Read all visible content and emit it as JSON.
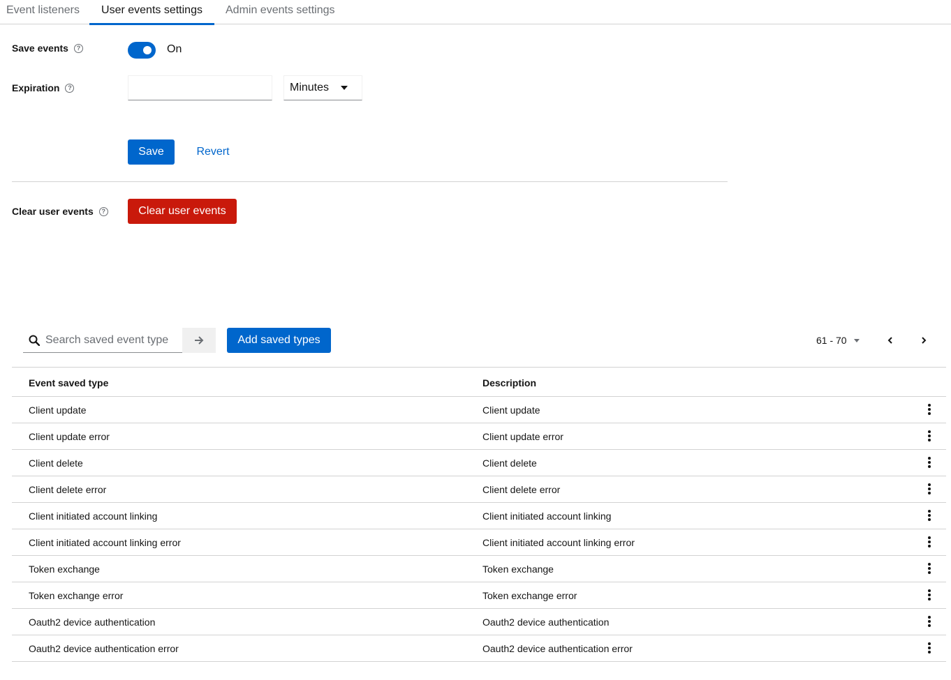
{
  "tabs": [
    {
      "label": "Event listeners"
    },
    {
      "label": "User events settings"
    },
    {
      "label": "Admin events settings"
    }
  ],
  "save_events": {
    "label": "Save events",
    "state_label": "On"
  },
  "expiration": {
    "label": "Expiration",
    "value": "",
    "unit": "Minutes"
  },
  "actions": {
    "save": "Save",
    "revert": "Revert"
  },
  "clear": {
    "label": "Clear user events",
    "button": "Clear user events"
  },
  "toolbar": {
    "search_placeholder": "Search saved event type",
    "add_button": "Add saved types",
    "range": "61 - 70"
  },
  "table": {
    "headers": [
      "Event saved type",
      "Description"
    ],
    "rows": [
      {
        "type": "Client update",
        "description": "Client update"
      },
      {
        "type": "Client update error",
        "description": "Client update error"
      },
      {
        "type": "Client delete",
        "description": "Client delete"
      },
      {
        "type": "Client delete error",
        "description": "Client delete error"
      },
      {
        "type": "Client initiated account linking",
        "description": "Client initiated account linking"
      },
      {
        "type": "Client initiated account linking error",
        "description": "Client initiated account linking error"
      },
      {
        "type": "Token exchange",
        "description": "Token exchange"
      },
      {
        "type": "Token exchange error",
        "description": "Token exchange error"
      },
      {
        "type": "Oauth2 device authentication",
        "description": "Oauth2 device authentication"
      },
      {
        "type": "Oauth2 device authentication error",
        "description": "Oauth2 device authentication error"
      }
    ]
  },
  "colors": {
    "primary": "#0066cc",
    "danger": "#c9190b",
    "border": "#d2d2d2"
  }
}
